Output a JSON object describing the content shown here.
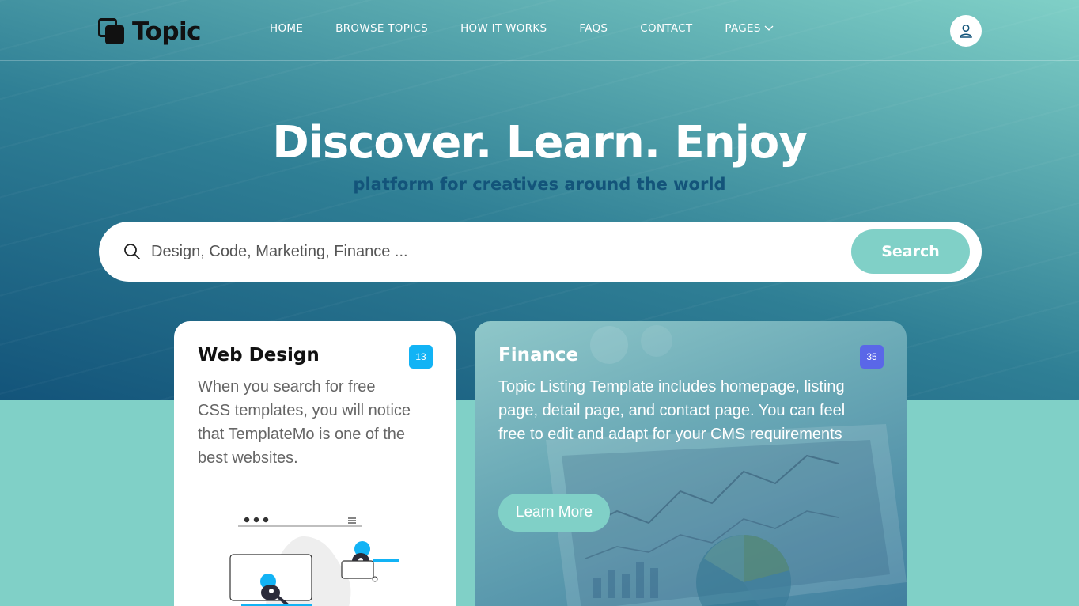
{
  "brand": {
    "name": "Topic",
    "icon": "overlapping-squares-logo"
  },
  "nav": {
    "items": [
      {
        "label": "HOME"
      },
      {
        "label": "BROWSE TOPICS"
      },
      {
        "label": "HOW IT WORKS"
      },
      {
        "label": "FAQS"
      },
      {
        "label": "CONTACT"
      },
      {
        "label": "PAGES",
        "icon": "chevron-down-icon"
      }
    ],
    "user_icon": "user-icon"
  },
  "hero": {
    "title": "Discover. Learn. Enjoy",
    "subtitle": "platform for creatives around the world"
  },
  "search": {
    "placeholder": "Design, Code, Marketing, Finance ...",
    "button_label": "Search",
    "icon": "search-icon"
  },
  "cards": [
    {
      "title": "Web Design",
      "badge": "13",
      "description": "When you search for free CSS templates, you will notice that TemplateMo is one of the best websites."
    },
    {
      "title": "Finance",
      "badge": "35",
      "description": "Topic Listing Template includes homepage, listing page, detail page, and contact page. You can feel free to edit and adapt for your CMS requirements",
      "button_label": "Learn More"
    }
  ],
  "colors": {
    "primary": "#13547a",
    "secondary": "#80d0c7",
    "badge_blue": "#12b3f5",
    "badge_indigo": "#5a67e8"
  }
}
